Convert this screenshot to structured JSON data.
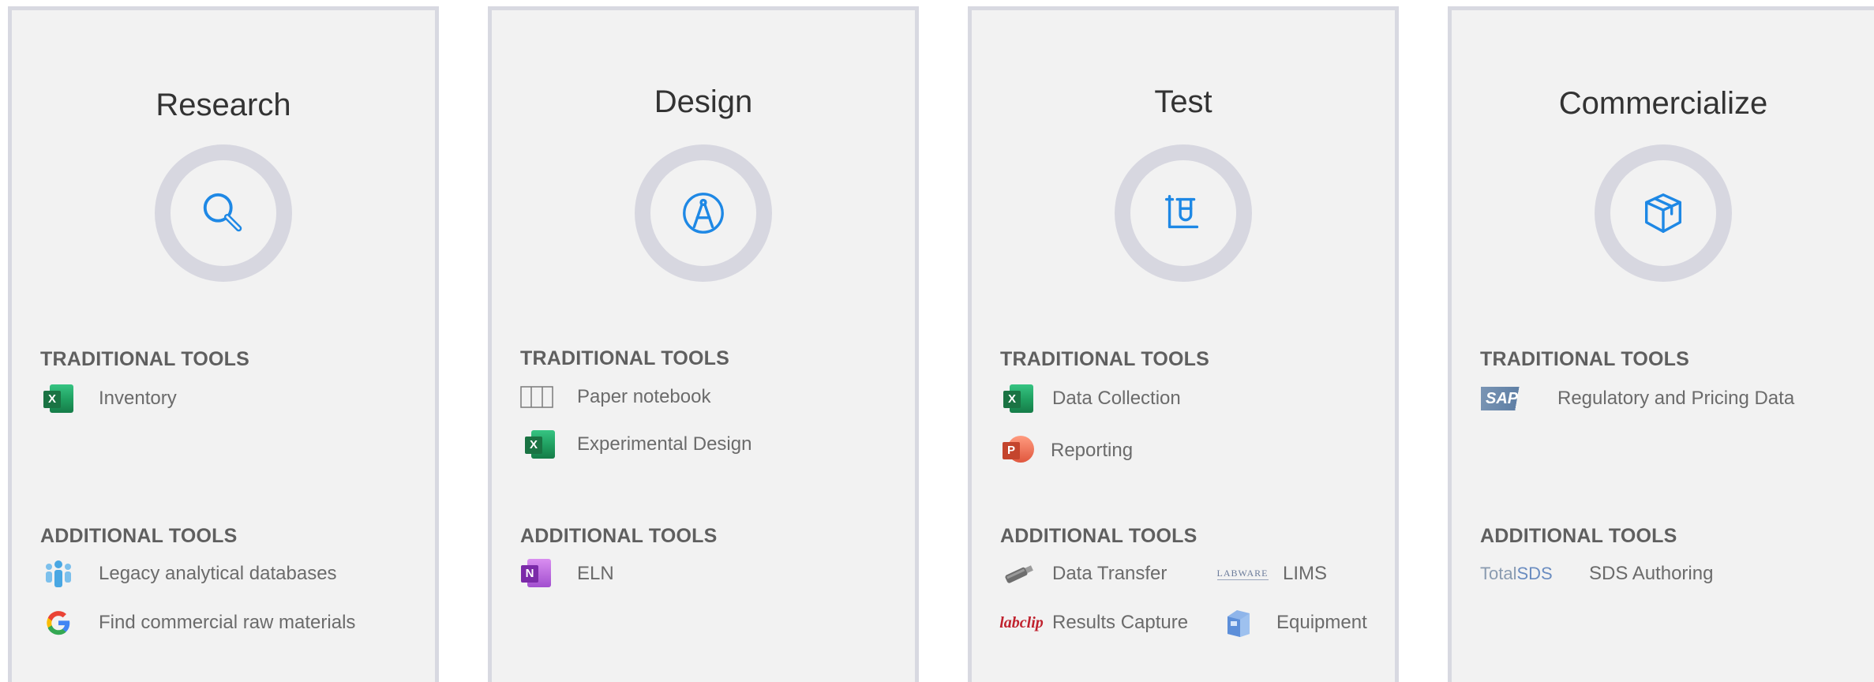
{
  "panels": [
    {
      "title": "Research",
      "icon": "search-icon",
      "traditional_heading": "TRADITIONAL TOOLS",
      "traditional_tools": [
        {
          "label": "Inventory",
          "icon": "excel-icon"
        }
      ],
      "additional_heading": "ADDITIONAL TOOLS",
      "additional_tools": [
        {
          "label": "Legacy analytical databases",
          "icon": "people-group-icon"
        },
        {
          "label": "Find commercial raw materials",
          "icon": "google-icon"
        }
      ]
    },
    {
      "title": "Design",
      "icon": "drafting-compass-icon",
      "traditional_heading": "TRADITIONAL TOOLS",
      "traditional_tools": [
        {
          "label": "Paper notebook",
          "icon": "notebook-icon"
        },
        {
          "label": "Experimental Design",
          "icon": "excel-icon"
        }
      ],
      "additional_heading": "ADDITIONAL TOOLS",
      "additional_tools": [
        {
          "label": "ELN",
          "icon": "onenote-icon"
        }
      ]
    },
    {
      "title": "Test",
      "icon": "beaker-icon",
      "traditional_heading": "TRADITIONAL TOOLS",
      "traditional_tools": [
        {
          "label": "Data Collection",
          "icon": "excel-icon"
        },
        {
          "label": "Reporting",
          "icon": "powerpoint-icon"
        }
      ],
      "additional_heading": "ADDITIONAL TOOLS",
      "additional_tools": [
        {
          "label": "Data Transfer",
          "icon": "usb-drive-icon"
        },
        {
          "label": "LIMS",
          "icon": "labware-logo-icon",
          "logo_text": "LABWARE"
        },
        {
          "label": "Results Capture",
          "icon": "labclip-logo-icon",
          "logo_text": "labclip"
        },
        {
          "label": "Equipment",
          "icon": "instrument-icon"
        }
      ]
    },
    {
      "title": "Commercialize",
      "icon": "package-box-icon",
      "traditional_heading": "TRADITIONAL TOOLS",
      "traditional_tools": [
        {
          "label": "Regulatory and Pricing Data",
          "icon": "sap-logo-icon",
          "logo_text": "SAP"
        }
      ],
      "additional_heading": "ADDITIONAL TOOLS",
      "additional_tools": [
        {
          "label": "SDS Authoring",
          "icon": "totalsds-logo-icon",
          "logo_text_a": "Total",
          "logo_text_b": "SDS"
        }
      ]
    }
  ],
  "colors": {
    "panel_bg": "#f2f2f2",
    "panel_border": "#d8d9e1",
    "ring": "#d7d7e0",
    "accent_icon": "#1e88e5",
    "heading_text": "#5f5f5f",
    "tool_text": "#6b6b6b"
  }
}
